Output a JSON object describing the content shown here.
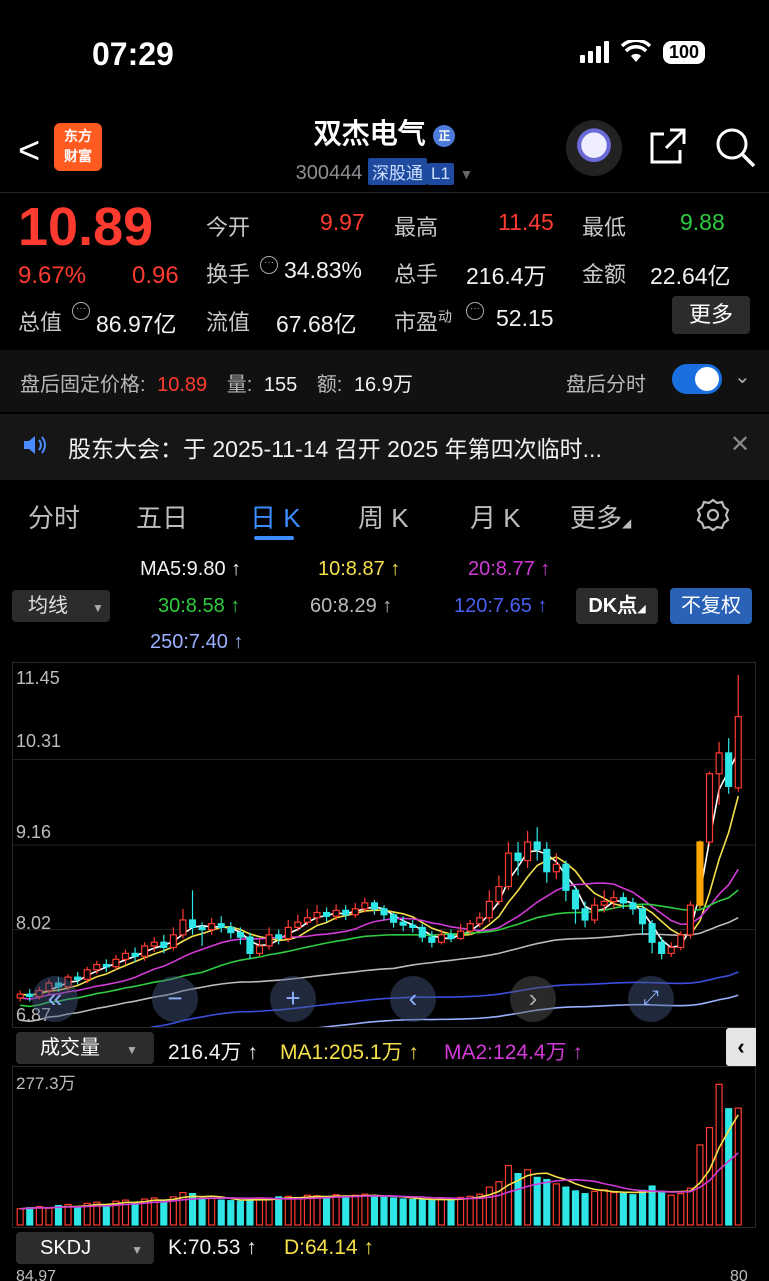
{
  "status": {
    "time": "07:29",
    "battery": "100"
  },
  "header": {
    "back_glyph": "<",
    "logo_line1": "东方",
    "logo_line2": "财富",
    "title": "双杰电气",
    "title_badge": "正",
    "code": "300444",
    "tag1": "深股通",
    "tag2": "L1"
  },
  "quote": {
    "price": "10.89",
    "pct": "9.67%",
    "change": "0.96",
    "open_label": "今开",
    "open": "9.97",
    "high_label": "最高",
    "high": "11.45",
    "low_label": "最低",
    "low": "9.88",
    "turnover_label": "换手",
    "turnover": "34.83%",
    "volume_label": "总手",
    "volume": "216.4万",
    "amount_label": "金额",
    "amount": "22.64亿",
    "mktcap_label": "总值",
    "mktcap": "86.97亿",
    "float_label": "流值",
    "float": "67.68亿",
    "pe_label": "市盈",
    "pe_sup": "动",
    "pe": "52.15",
    "more": "更多"
  },
  "afterhours": {
    "label": "盘后固定价格:",
    "price": "10.89",
    "vol_label": "量:",
    "vol": "155",
    "amt_label": "额:",
    "amt": "16.9万",
    "toggle_label": "盘后分时",
    "toggle_on": true
  },
  "notice": {
    "text": "股东大会：于 2025-11-14 召开 2025 年第四次临时..."
  },
  "tabs": [
    {
      "label": "分时",
      "active": false
    },
    {
      "label": "五日",
      "active": false
    },
    {
      "label": "日 K",
      "active": true
    },
    {
      "label": "周 K",
      "active": false
    },
    {
      "label": "月 K",
      "active": false
    },
    {
      "label": "更多",
      "active": false
    }
  ],
  "ma_legend": {
    "select": "均线",
    "ma5": "MA5:9.80 ↑",
    "ma10": "10:8.87 ↑",
    "ma20": "20:8.77 ↑",
    "ma30": "30:8.58 ↑",
    "ma60": "60:8.29 ↑",
    "ma120": "120:7.65 ↑",
    "ma250": "250:7.40 ↑",
    "dk": "DK点",
    "fq": "不复权"
  },
  "colors": {
    "up": "#ff3b30",
    "down": "#2ee6e6",
    "ma5": "#ffffff",
    "ma10": "#f5e04a",
    "ma20": "#d03ad6",
    "ma30": "#2ecc40",
    "ma60": "#bbbbbb",
    "ma120": "#3a4fe0",
    "ma250": "#9ab0ff",
    "accent": "#3b8cff"
  },
  "chart_data": {
    "type": "candlestick",
    "y_ticks": [
      "11.45",
      "10.31",
      "9.16",
      "8.02",
      "6.87"
    ],
    "ylim": [
      6.87,
      11.45
    ],
    "candles": [
      [
        7.1,
        7.15,
        7.05,
        7.2
      ],
      [
        7.15,
        7.12,
        7.05,
        7.22
      ],
      [
        7.12,
        7.2,
        7.08,
        7.25
      ],
      [
        7.2,
        7.3,
        7.15,
        7.35
      ],
      [
        7.3,
        7.25,
        7.18,
        7.38
      ],
      [
        7.25,
        7.38,
        7.2,
        7.42
      ],
      [
        7.38,
        7.35,
        7.28,
        7.45
      ],
      [
        7.35,
        7.48,
        7.3,
        7.52
      ],
      [
        7.48,
        7.55,
        7.42,
        7.6
      ],
      [
        7.55,
        7.52,
        7.45,
        7.62
      ],
      [
        7.52,
        7.62,
        7.48,
        7.68
      ],
      [
        7.62,
        7.7,
        7.55,
        7.75
      ],
      [
        7.7,
        7.66,
        7.58,
        7.78
      ],
      [
        7.66,
        7.8,
        7.6,
        7.85
      ],
      [
        7.8,
        7.85,
        7.72,
        7.92
      ],
      [
        7.85,
        7.78,
        7.7,
        7.95
      ],
      [
        7.78,
        7.95,
        7.74,
        8.05
      ],
      [
        7.95,
        8.15,
        7.9,
        8.3
      ],
      [
        8.15,
        8.05,
        7.95,
        8.55
      ],
      [
        8.05,
        8.02,
        7.8,
        8.12
      ],
      [
        8.02,
        8.1,
        7.95,
        8.18
      ],
      [
        8.1,
        8.05,
        7.98,
        8.2
      ],
      [
        8.05,
        7.98,
        7.9,
        8.12
      ],
      [
        7.98,
        7.92,
        7.82,
        8.05
      ],
      [
        7.92,
        7.7,
        7.62,
        7.98
      ],
      [
        7.7,
        7.8,
        7.66,
        7.88
      ],
      [
        7.8,
        7.95,
        7.75,
        8.05
      ],
      [
        7.95,
        7.9,
        7.82,
        8.02
      ],
      [
        7.9,
        8.05,
        7.85,
        8.15
      ],
      [
        8.05,
        8.12,
        8.0,
        8.22
      ],
      [
        8.12,
        8.18,
        8.08,
        8.3
      ],
      [
        8.18,
        8.25,
        8.1,
        8.35
      ],
      [
        8.25,
        8.2,
        8.12,
        8.32
      ],
      [
        8.2,
        8.28,
        8.15,
        8.36
      ],
      [
        8.28,
        8.22,
        8.15,
        8.35
      ],
      [
        8.22,
        8.3,
        8.18,
        8.38
      ],
      [
        8.3,
        8.38,
        8.25,
        8.45
      ],
      [
        8.38,
        8.3,
        8.22,
        8.42
      ],
      [
        8.3,
        8.22,
        8.15,
        8.35
      ],
      [
        8.22,
        8.12,
        8.05,
        8.25
      ],
      [
        8.12,
        8.08,
        8.0,
        8.2
      ],
      [
        8.08,
        8.05,
        7.98,
        8.15
      ],
      [
        8.05,
        7.92,
        7.85,
        8.1
      ],
      [
        7.92,
        7.85,
        7.78,
        8.0
      ],
      [
        7.85,
        7.95,
        7.82,
        8.02
      ],
      [
        7.95,
        7.9,
        7.85,
        8.02
      ],
      [
        7.9,
        8.0,
        7.88,
        8.1
      ],
      [
        8.0,
        8.1,
        7.95,
        8.15
      ],
      [
        8.1,
        8.18,
        8.05,
        8.25
      ],
      [
        8.18,
        8.4,
        8.12,
        8.55
      ],
      [
        8.4,
        8.6,
        8.35,
        8.75
      ],
      [
        8.6,
        9.05,
        8.55,
        9.2
      ],
      [
        9.05,
        8.95,
        8.75,
        9.2
      ],
      [
        8.95,
        9.2,
        8.85,
        9.35
      ],
      [
        9.2,
        9.1,
        8.95,
        9.4
      ],
      [
        9.1,
        8.8,
        8.65,
        9.2
      ],
      [
        8.8,
        8.9,
        8.7,
        9.05
      ],
      [
        8.9,
        8.55,
        8.4,
        8.95
      ],
      [
        8.55,
        8.3,
        8.1,
        8.6
      ],
      [
        8.3,
        8.15,
        8.05,
        8.4
      ],
      [
        8.15,
        8.35,
        8.1,
        8.45
      ],
      [
        8.35,
        8.4,
        8.25,
        8.55
      ],
      [
        8.4,
        8.45,
        8.3,
        8.55
      ],
      [
        8.45,
        8.38,
        8.3,
        8.52
      ],
      [
        8.38,
        8.3,
        8.22,
        8.45
      ],
      [
        8.3,
        8.1,
        7.95,
        8.35
      ],
      [
        8.1,
        7.85,
        7.7,
        8.15
      ],
      [
        7.85,
        7.7,
        7.62,
        7.92
      ],
      [
        7.7,
        7.78,
        7.65,
        7.85
      ],
      [
        7.78,
        7.95,
        7.74,
        8.0
      ],
      [
        7.95,
        8.35,
        7.9,
        8.4
      ],
      [
        8.35,
        9.2,
        8.3,
        9.22
      ],
      [
        9.2,
        10.12,
        9.15,
        10.15
      ],
      [
        10.12,
        10.4,
        9.7,
        10.55
      ],
      [
        10.4,
        9.95,
        9.85,
        10.6
      ],
      [
        9.93,
        10.89,
        9.88,
        11.45
      ]
    ],
    "volume_ticks": [
      "277.3万"
    ],
    "volumes": [
      30,
      32,
      34,
      31,
      36,
      38,
      33,
      40,
      42,
      37,
      44,
      46,
      41,
      48,
      50,
      45,
      52,
      60,
      58,
      47,
      49,
      46,
      45,
      44,
      48,
      50,
      47,
      52,
      53,
      50,
      55,
      54,
      51,
      56,
      52,
      55,
      57,
      54,
      51,
      50,
      48,
      47,
      46,
      45,
      49,
      48,
      51,
      53,
      57,
      70,
      80,
      110,
      95,
      102,
      88,
      84,
      76,
      70,
      63,
      58,
      62,
      65,
      60,
      58,
      56,
      64,
      72,
      60,
      55,
      58,
      68,
      148,
      180,
      260,
      215,
      216
    ],
    "volume_max": 277.3,
    "volume_legend": {
      "select": "成交量",
      "vol": "216.4万 ↑",
      "ma1": "MA1:205.1万 ↑",
      "ma2": "MA2:124.4万 ↑"
    },
    "skdj": {
      "select": "SKDJ",
      "k": "K:70.53 ↑",
      "d": "D:64.14 ↑",
      "left_tick": "84.97",
      "right_tick": "80"
    }
  }
}
